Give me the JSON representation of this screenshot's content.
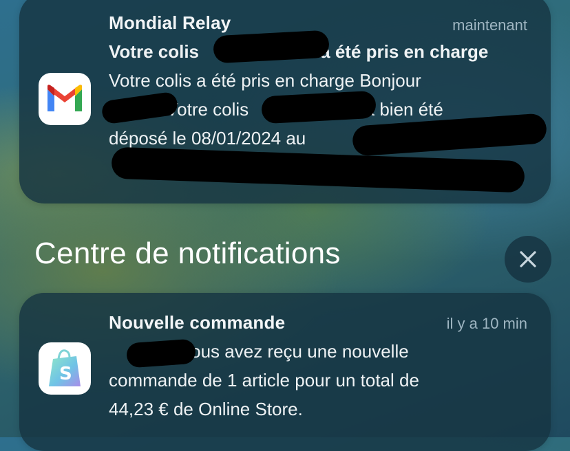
{
  "notifications": [
    {
      "app": "Mondial Relay",
      "time": "maintenant",
      "icon": "gmail-icon",
      "subject_a": "Votre colis",
      "subject_b": "0 a été pris en charge",
      "body_line1": "Votre colis a été pris en charge Bonjour",
      "body_line2": "Votre colis",
      "body_line2b": "a bien été",
      "body_line3": "déposé le 08/01/2024 au"
    },
    {
      "app": "Nouvelle commande",
      "time": "il y a 10 min",
      "icon": "shopify-icon",
      "body_line1": "Vous avez reçu une nouvelle",
      "body_line2": "commande de 1 article pour un total de",
      "body_line3": "44,23 € de Online Store."
    }
  ],
  "section_title": "Centre de notifications",
  "close_label": "×",
  "colors": {
    "card": "#163442",
    "gmail_red": "#ea4335",
    "gmail_blue": "#4285f4",
    "gmail_green": "#34a853",
    "gmail_yellow": "#fbbc04",
    "shopify_green": "#95bf47"
  }
}
